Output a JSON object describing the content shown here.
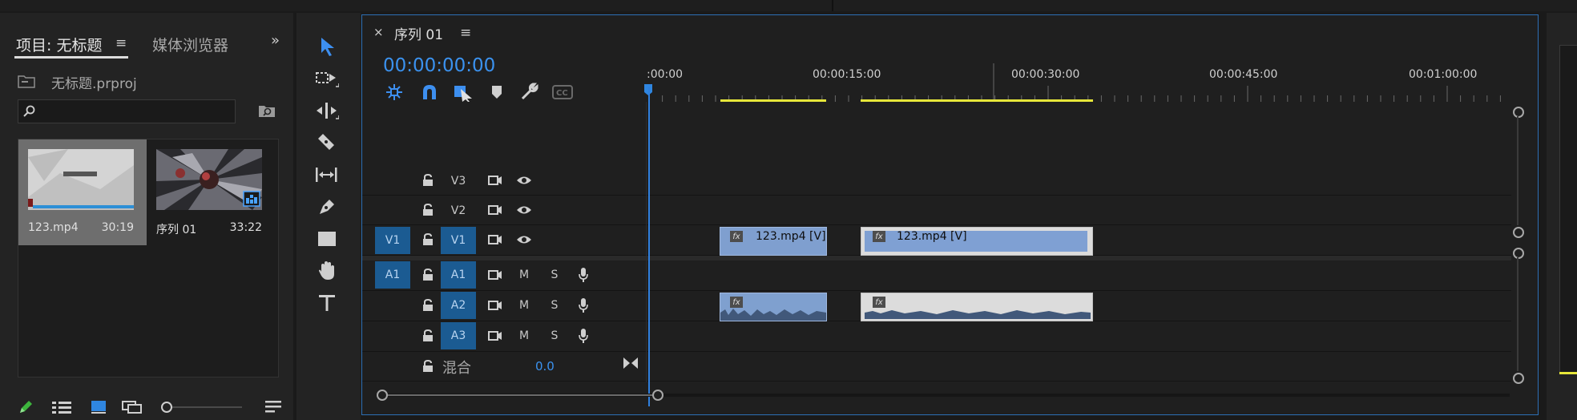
{
  "project": {
    "tab_active": "项目: 无标题",
    "tab_inactive": "媒体浏览器",
    "project_file": "无标题.prproj",
    "search_value": "",
    "items": [
      {
        "name": "123.mp4",
        "duration": "30:19"
      },
      {
        "name": "序列 01",
        "duration": "33:22"
      }
    ]
  },
  "tools": [
    "selection-tool",
    "track-select-tool",
    "ripple-edit-tool",
    "razor-tool",
    "slip-tool",
    "pen-tool",
    "rectangle-tool",
    "hand-tool",
    "type-tool"
  ],
  "timeline": {
    "sequence_name": "序列 01",
    "timecode": "00:00:00:00",
    "ruler_labels": [
      ":00:00",
      "00:00:15:00",
      "00:00:30:00",
      "00:00:45:00",
      "00:01:00:00"
    ],
    "video_tracks": [
      "V3",
      "V2",
      "V1"
    ],
    "audio_tracks": [
      "A1",
      "A2",
      "A3"
    ],
    "source_video": "V1",
    "source_audio": "A1",
    "mute_label": "M",
    "solo_label": "S",
    "mix_label": "混合",
    "mix_value": "0.0",
    "clips": {
      "video_1": "123.mp4 [V]",
      "video_2": "123.mp4 [V]",
      "fx": "fx"
    }
  },
  "colors": {
    "accent": "#3b92ef",
    "clip_video": "#8aa9d6",
    "clip_audio": "#7fa0cf",
    "in_out": "#e6e63a",
    "panel_border": "#2d6fb5"
  }
}
